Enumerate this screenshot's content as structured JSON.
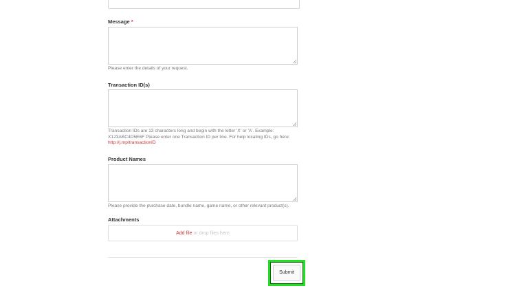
{
  "form": {
    "message": {
      "label": "Message",
      "required_mark": "*",
      "hint": "Please enter the details of your request."
    },
    "transaction_ids": {
      "label": "Transaction ID(s)",
      "hint_text": "Transaction IDs are 13 characters long and begin with the letter 'X' or 'A'. Example: X123ABC4D5E6F Please enter one Transaction ID per line. For help locating IDs, go here: ",
      "hint_link": "http://j.mp/transactionID"
    },
    "product_names": {
      "label": "Product Names",
      "hint": "Please provide the purchase date, bundle name, game name, or other relevant product(s)."
    },
    "attachments": {
      "label": "Attachments",
      "add_file": "Add file",
      "drop_text": " or drop files here"
    },
    "submit_label": "Submit"
  },
  "colors": {
    "required": "#cc3333",
    "link": "#cc3333",
    "highlight": "#22dd22"
  }
}
